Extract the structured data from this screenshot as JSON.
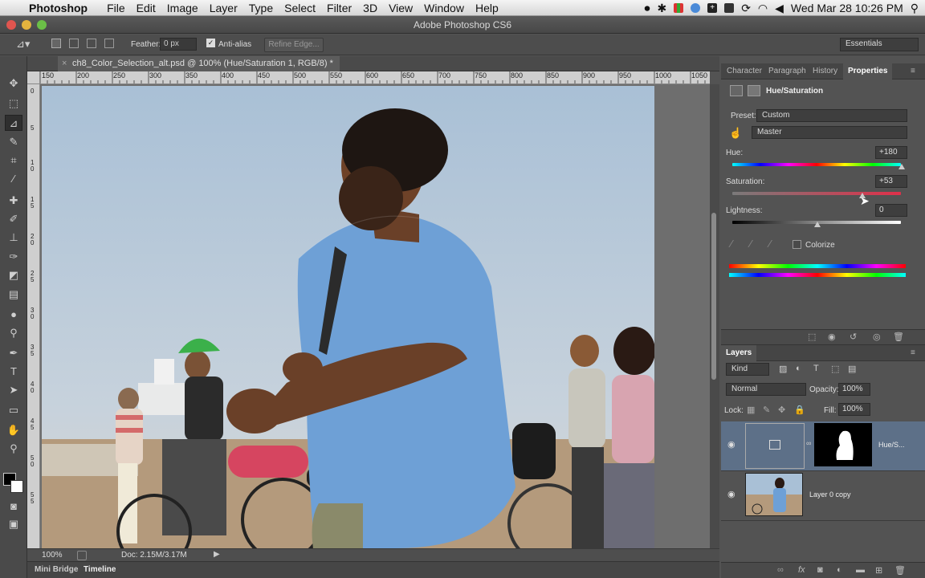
{
  "menubar": {
    "app": "Photoshop",
    "items": [
      "File",
      "Edit",
      "Image",
      "Layer",
      "Type",
      "Select",
      "Filter",
      "3D",
      "View",
      "Window",
      "Help"
    ],
    "clock": "Wed Mar 28  10:26 PM"
  },
  "window": {
    "title": "Adobe Photoshop CS6"
  },
  "options": {
    "feather_label": "Feather:",
    "feather_value": "0 px",
    "antialias_label": "Anti-alias",
    "refine_edge": "Refine Edge...",
    "workspace": "Essentials"
  },
  "document": {
    "tab_title": "ch8_Color_Selection_alt.psd @ 100% (Hue/Saturation 1, RGB/8) *",
    "zoom": "100%",
    "doc_size": "Doc: 2.15M/3.17M"
  },
  "rulers": {
    "h": [
      "150",
      "200",
      "250",
      "300",
      "350",
      "400",
      "450",
      "500",
      "550",
      "600",
      "650",
      "700",
      "750",
      "800",
      "850",
      "900",
      "950",
      "1000",
      "1050"
    ],
    "v": [
      "0",
      "5",
      "1 0",
      "1 5",
      "2 0",
      "2 5",
      "3 0",
      "3 5",
      "4 0",
      "4 5",
      "5 0",
      "5 5"
    ]
  },
  "bottom_tabs": [
    "Mini Bridge",
    "Timeline"
  ],
  "properties": {
    "tabs": [
      "Character",
      "Paragraph",
      "History",
      "Properties"
    ],
    "active_tab": "Properties",
    "title": "Hue/Saturation",
    "preset_label": "Preset:",
    "preset_value": "Custom",
    "channel_value": "Master",
    "hue_label": "Hue:",
    "hue_value": "+180",
    "saturation_label": "Saturation:",
    "saturation_value": "+53",
    "lightness_label": "Lightness:",
    "lightness_value": "0",
    "colorize_label": "Colorize"
  },
  "layers": {
    "tab": "Layers",
    "kind_label": "Kind",
    "blend_mode": "Normal",
    "opacity_label": "Opacity:",
    "opacity_value": "100%",
    "lock_label": "Lock:",
    "fill_label": "Fill:",
    "fill_value": "100%",
    "items": [
      {
        "name": "Hue/S..."
      },
      {
        "name": "Layer 0 copy"
      }
    ]
  },
  "colors": {
    "panel_bg": "#535353",
    "selected_layer": "#5d7088",
    "sky": "#a9c0d6",
    "shirt": "#6ea0d6"
  }
}
